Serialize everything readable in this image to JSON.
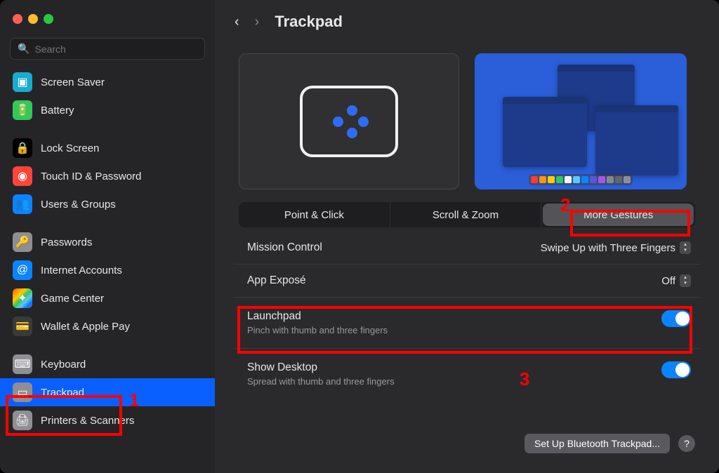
{
  "window": {
    "title": "Trackpad"
  },
  "search": {
    "placeholder": "Search"
  },
  "sidebar": {
    "items": [
      {
        "label": "Screen Saver",
        "icon": "ic-cyan",
        "glyph": "▢"
      },
      {
        "label": "Battery",
        "icon": "ic-green",
        "glyph": "▬"
      },
      {
        "label": "Lock Screen",
        "icon": "ic-black",
        "glyph": "🔒"
      },
      {
        "label": "Touch ID & Password",
        "icon": "ic-red",
        "glyph": "◉"
      },
      {
        "label": "Users & Groups",
        "icon": "ic-blue",
        "glyph": "👥"
      },
      {
        "label": "Passwords",
        "icon": "ic-gray",
        "glyph": "🔑"
      },
      {
        "label": "Internet Accounts",
        "icon": "ic-blue",
        "glyph": "@"
      },
      {
        "label": "Game Center",
        "icon": "ic-multi",
        "glyph": "✦"
      },
      {
        "label": "Wallet & Apple Pay",
        "icon": "ic-dark",
        "glyph": "💳"
      },
      {
        "label": "Keyboard",
        "icon": "ic-gray",
        "glyph": "⌨"
      },
      {
        "label": "Trackpad",
        "icon": "ic-gray",
        "glyph": "⊡"
      },
      {
        "label": "Printers & Scanners",
        "icon": "ic-gray",
        "glyph": "🖨"
      }
    ]
  },
  "tabs": [
    {
      "label": "Point & Click"
    },
    {
      "label": "Scroll & Zoom"
    },
    {
      "label": "More Gestures"
    }
  ],
  "settings": {
    "mission_control": {
      "label": "Mission Control",
      "value": "Swipe Up with Three Fingers"
    },
    "app_expose": {
      "label": "App Exposé",
      "value": "Off"
    },
    "launchpad": {
      "label": "Launchpad",
      "sub": "Pinch with thumb and three fingers",
      "on": true
    },
    "show_desktop": {
      "label": "Show Desktop",
      "sub": "Spread with thumb and three fingers",
      "on": true
    }
  },
  "bottom": {
    "bluetooth": "Set Up Bluetooth Trackpad...",
    "help": "?"
  },
  "annotations": {
    "a1": "1",
    "a2": "2",
    "a3": "3"
  },
  "dock_colors": [
    "#ff3b30",
    "#ff9500",
    "#ffcc00",
    "#34c759",
    "#fff",
    "#5ac8fa",
    "#0a84ff",
    "#5856d6",
    "#af52de",
    "#888",
    "#666",
    "#8e8e93"
  ]
}
